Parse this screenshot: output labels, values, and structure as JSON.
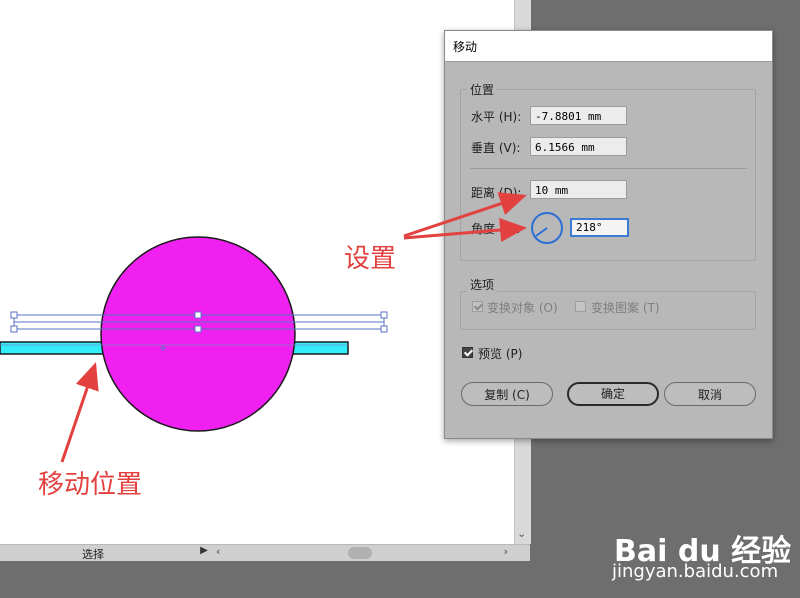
{
  "dialog": {
    "title": "移动",
    "position_group": "位置",
    "horizontal_label": "水平 (H):",
    "horizontal_value": "-7.8801 mm",
    "vertical_label": "垂直 (V):",
    "vertical_value": "6.1566 mm",
    "distance_label": "距离 (D):",
    "distance_value": "10 mm",
    "angle_label": "角度 (A):",
    "angle_value": "218°",
    "options_group": "选项",
    "transform_objects_label": "变换对象 (O)",
    "transform_patterns_label": "变换图案 (T)",
    "preview_label": "预览 (P)",
    "copy_button": "复制 (C)",
    "ok_button": "确定",
    "cancel_button": "取消"
  },
  "statusbar": {
    "tool_label": "选择"
  },
  "annotations": {
    "settings": "设置",
    "move_position": "移动位置"
  },
  "watermark": {
    "logo": "Bai du 经验",
    "url": "jingyan.baidu.com"
  },
  "colors": {
    "circle_fill": "#f020f0",
    "bar_fill": "#33eef8",
    "annotation": "#e3413f",
    "angle_dial": "#2b6fd6"
  }
}
